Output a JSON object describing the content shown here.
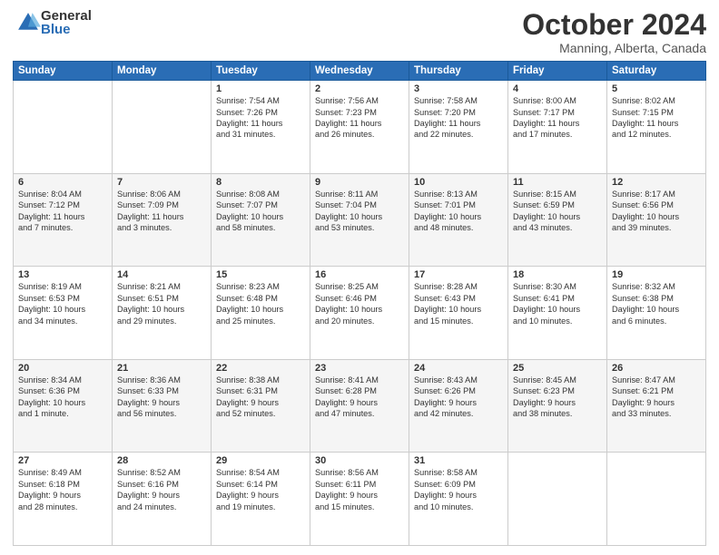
{
  "logo": {
    "general": "General",
    "blue": "Blue"
  },
  "title": {
    "month": "October 2024",
    "location": "Manning, Alberta, Canada"
  },
  "weekdays": [
    "Sunday",
    "Monday",
    "Tuesday",
    "Wednesday",
    "Thursday",
    "Friday",
    "Saturday"
  ],
  "weeks": [
    [
      {
        "day": "",
        "lines": []
      },
      {
        "day": "",
        "lines": []
      },
      {
        "day": "1",
        "lines": [
          "Sunrise: 7:54 AM",
          "Sunset: 7:26 PM",
          "Daylight: 11 hours",
          "and 31 minutes."
        ]
      },
      {
        "day": "2",
        "lines": [
          "Sunrise: 7:56 AM",
          "Sunset: 7:23 PM",
          "Daylight: 11 hours",
          "and 26 minutes."
        ]
      },
      {
        "day": "3",
        "lines": [
          "Sunrise: 7:58 AM",
          "Sunset: 7:20 PM",
          "Daylight: 11 hours",
          "and 22 minutes."
        ]
      },
      {
        "day": "4",
        "lines": [
          "Sunrise: 8:00 AM",
          "Sunset: 7:17 PM",
          "Daylight: 11 hours",
          "and 17 minutes."
        ]
      },
      {
        "day": "5",
        "lines": [
          "Sunrise: 8:02 AM",
          "Sunset: 7:15 PM",
          "Daylight: 11 hours",
          "and 12 minutes."
        ]
      }
    ],
    [
      {
        "day": "6",
        "lines": [
          "Sunrise: 8:04 AM",
          "Sunset: 7:12 PM",
          "Daylight: 11 hours",
          "and 7 minutes."
        ]
      },
      {
        "day": "7",
        "lines": [
          "Sunrise: 8:06 AM",
          "Sunset: 7:09 PM",
          "Daylight: 11 hours",
          "and 3 minutes."
        ]
      },
      {
        "day": "8",
        "lines": [
          "Sunrise: 8:08 AM",
          "Sunset: 7:07 PM",
          "Daylight: 10 hours",
          "and 58 minutes."
        ]
      },
      {
        "day": "9",
        "lines": [
          "Sunrise: 8:11 AM",
          "Sunset: 7:04 PM",
          "Daylight: 10 hours",
          "and 53 minutes."
        ]
      },
      {
        "day": "10",
        "lines": [
          "Sunrise: 8:13 AM",
          "Sunset: 7:01 PM",
          "Daylight: 10 hours",
          "and 48 minutes."
        ]
      },
      {
        "day": "11",
        "lines": [
          "Sunrise: 8:15 AM",
          "Sunset: 6:59 PM",
          "Daylight: 10 hours",
          "and 43 minutes."
        ]
      },
      {
        "day": "12",
        "lines": [
          "Sunrise: 8:17 AM",
          "Sunset: 6:56 PM",
          "Daylight: 10 hours",
          "and 39 minutes."
        ]
      }
    ],
    [
      {
        "day": "13",
        "lines": [
          "Sunrise: 8:19 AM",
          "Sunset: 6:53 PM",
          "Daylight: 10 hours",
          "and 34 minutes."
        ]
      },
      {
        "day": "14",
        "lines": [
          "Sunrise: 8:21 AM",
          "Sunset: 6:51 PM",
          "Daylight: 10 hours",
          "and 29 minutes."
        ]
      },
      {
        "day": "15",
        "lines": [
          "Sunrise: 8:23 AM",
          "Sunset: 6:48 PM",
          "Daylight: 10 hours",
          "and 25 minutes."
        ]
      },
      {
        "day": "16",
        "lines": [
          "Sunrise: 8:25 AM",
          "Sunset: 6:46 PM",
          "Daylight: 10 hours",
          "and 20 minutes."
        ]
      },
      {
        "day": "17",
        "lines": [
          "Sunrise: 8:28 AM",
          "Sunset: 6:43 PM",
          "Daylight: 10 hours",
          "and 15 minutes."
        ]
      },
      {
        "day": "18",
        "lines": [
          "Sunrise: 8:30 AM",
          "Sunset: 6:41 PM",
          "Daylight: 10 hours",
          "and 10 minutes."
        ]
      },
      {
        "day": "19",
        "lines": [
          "Sunrise: 8:32 AM",
          "Sunset: 6:38 PM",
          "Daylight: 10 hours",
          "and 6 minutes."
        ]
      }
    ],
    [
      {
        "day": "20",
        "lines": [
          "Sunrise: 8:34 AM",
          "Sunset: 6:36 PM",
          "Daylight: 10 hours",
          "and 1 minute."
        ]
      },
      {
        "day": "21",
        "lines": [
          "Sunrise: 8:36 AM",
          "Sunset: 6:33 PM",
          "Daylight: 9 hours",
          "and 56 minutes."
        ]
      },
      {
        "day": "22",
        "lines": [
          "Sunrise: 8:38 AM",
          "Sunset: 6:31 PM",
          "Daylight: 9 hours",
          "and 52 minutes."
        ]
      },
      {
        "day": "23",
        "lines": [
          "Sunrise: 8:41 AM",
          "Sunset: 6:28 PM",
          "Daylight: 9 hours",
          "and 47 minutes."
        ]
      },
      {
        "day": "24",
        "lines": [
          "Sunrise: 8:43 AM",
          "Sunset: 6:26 PM",
          "Daylight: 9 hours",
          "and 42 minutes."
        ]
      },
      {
        "day": "25",
        "lines": [
          "Sunrise: 8:45 AM",
          "Sunset: 6:23 PM",
          "Daylight: 9 hours",
          "and 38 minutes."
        ]
      },
      {
        "day": "26",
        "lines": [
          "Sunrise: 8:47 AM",
          "Sunset: 6:21 PM",
          "Daylight: 9 hours",
          "and 33 minutes."
        ]
      }
    ],
    [
      {
        "day": "27",
        "lines": [
          "Sunrise: 8:49 AM",
          "Sunset: 6:18 PM",
          "Daylight: 9 hours",
          "and 28 minutes."
        ]
      },
      {
        "day": "28",
        "lines": [
          "Sunrise: 8:52 AM",
          "Sunset: 6:16 PM",
          "Daylight: 9 hours",
          "and 24 minutes."
        ]
      },
      {
        "day": "29",
        "lines": [
          "Sunrise: 8:54 AM",
          "Sunset: 6:14 PM",
          "Daylight: 9 hours",
          "and 19 minutes."
        ]
      },
      {
        "day": "30",
        "lines": [
          "Sunrise: 8:56 AM",
          "Sunset: 6:11 PM",
          "Daylight: 9 hours",
          "and 15 minutes."
        ]
      },
      {
        "day": "31",
        "lines": [
          "Sunrise: 8:58 AM",
          "Sunset: 6:09 PM",
          "Daylight: 9 hours",
          "and 10 minutes."
        ]
      },
      {
        "day": "",
        "lines": []
      },
      {
        "day": "",
        "lines": []
      }
    ]
  ]
}
